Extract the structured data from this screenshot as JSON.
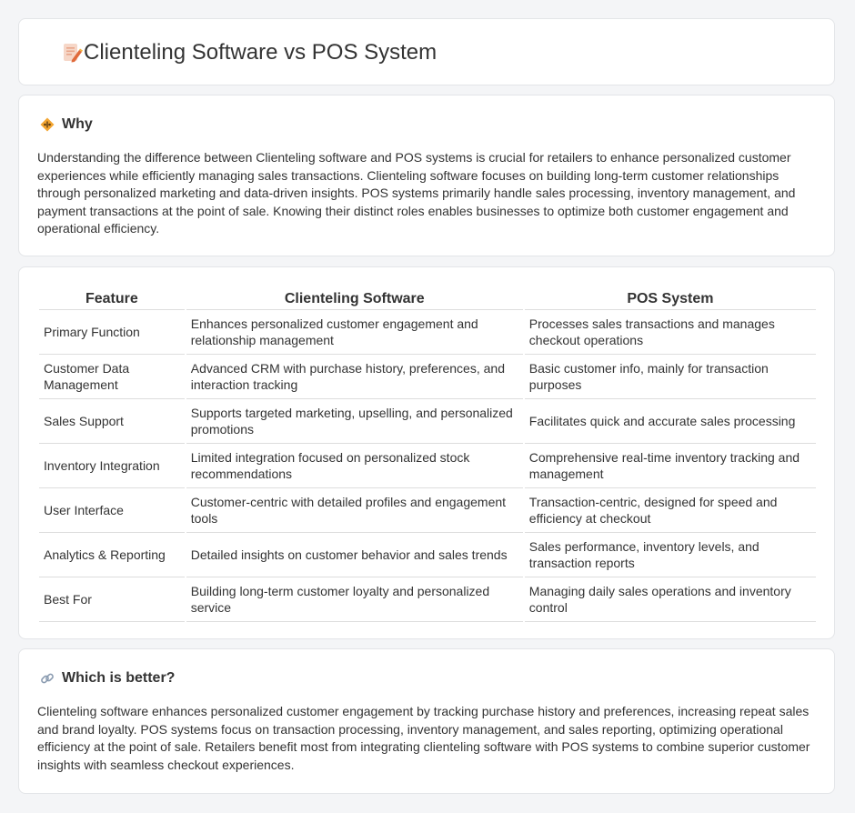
{
  "header": {
    "title": "Clienteling Software vs POS System",
    "icon": "document-edit-icon"
  },
  "why": {
    "title": "Why",
    "icon": "diamond-warning-icon",
    "text": "Understanding the difference between Clienteling software and POS systems is crucial for retailers to enhance personalized customer experiences while efficiently managing sales transactions. Clienteling software focuses on building long-term customer relationships through personalized marketing and data-driven insights. POS systems primarily handle sales processing, inventory management, and payment transactions at the point of sale. Knowing their distinct roles enables businesses to optimize both customer engagement and operational efficiency."
  },
  "table": {
    "headers": [
      "Feature",
      "Clienteling Software",
      "POS System"
    ],
    "rows": [
      [
        "Primary Function",
        "Enhances personalized customer engagement and relationship management",
        "Processes sales transactions and manages checkout operations"
      ],
      [
        "Customer Data Management",
        "Advanced CRM with purchase history, preferences, and interaction tracking",
        "Basic customer info, mainly for transaction purposes"
      ],
      [
        "Sales Support",
        "Supports targeted marketing, upselling, and personalized promotions",
        "Facilitates quick and accurate sales processing"
      ],
      [
        "Inventory Integration",
        "Limited integration focused on personalized stock recommendations",
        "Comprehensive real-time inventory tracking and management"
      ],
      [
        "User Interface",
        "Customer-centric with detailed profiles and engagement tools",
        "Transaction-centric, designed for speed and efficiency at checkout"
      ],
      [
        "Analytics & Reporting",
        "Detailed insights on customer behavior and sales trends",
        "Sales performance, inventory levels, and transaction reports"
      ],
      [
        "Best For",
        "Building long-term customer loyalty and personalized service",
        "Managing daily sales operations and inventory control"
      ]
    ]
  },
  "better": {
    "title": "Which is better?",
    "icon": "link-icon",
    "text": "Clienteling software enhances personalized customer engagement by tracking purchase history and preferences, increasing repeat sales and brand loyalty. POS systems focus on transaction processing, inventory management, and sales reporting, optimizing operational efficiency at the point of sale. Retailers benefit most from integrating clienteling software with POS systems to combine superior customer insights with seamless checkout experiences."
  }
}
